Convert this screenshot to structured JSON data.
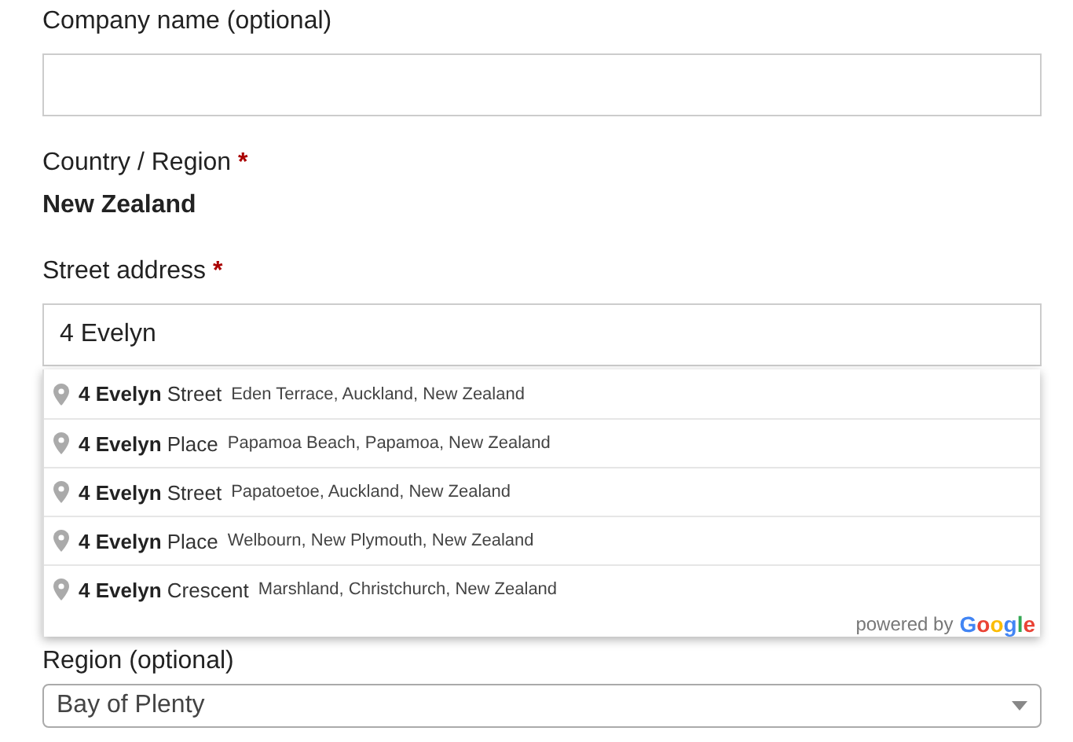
{
  "fields": [
    {
      "kind": "text",
      "label": "Company name (optional)"
    },
    {
      "kind": "static",
      "label": "Country / Region",
      "required_mark": "*",
      "value": "New Zealand"
    },
    {
      "kind": "text",
      "label": "Street address",
      "required_mark": "*",
      "value": "4 Evelyn",
      "suggestions": {
        "items": [
          {
            "main": "**4 Evelyn** Street",
            "secondary": "Eden Terrace, Auckland, New Zealand"
          },
          {
            "main": "**4 Evelyn** Place",
            "secondary": "Papamoa Beach, Papamoa, New Zealand"
          },
          {
            "main": "**4 Evelyn** Street",
            "secondary": "Papatoetoe, Auckland, New Zealand"
          },
          {
            "main": "**4 Evelyn** Place",
            "secondary": "Welbourn, New Plymouth, New Zealand"
          },
          {
            "main": "**4 Evelyn** Crescent",
            "secondary": "Marshland, Christchurch, New Zealand"
          }
        ],
        "attribution": "powered by",
        "logo": "Google"
      }
    },
    {
      "kind": "select",
      "label": "Region (optional)",
      "value": "Bay of Plenty"
    }
  ]
}
